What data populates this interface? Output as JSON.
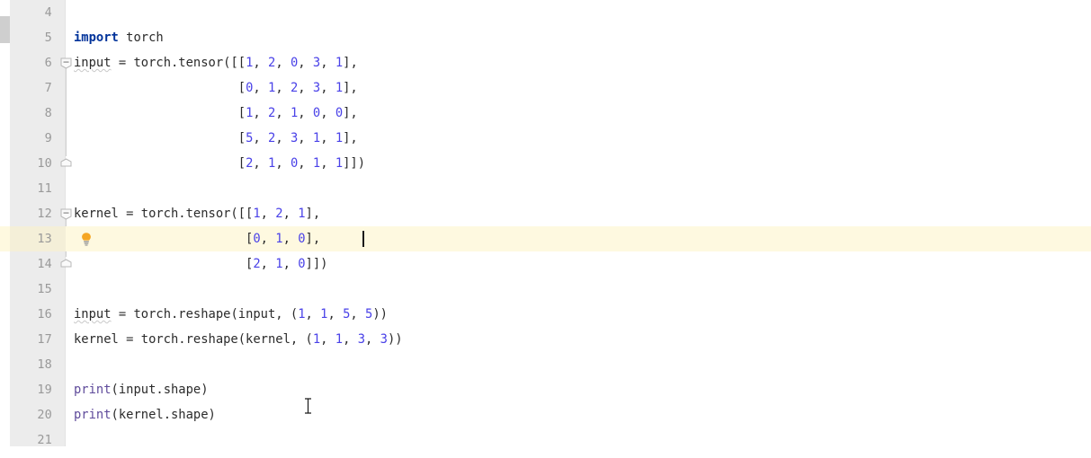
{
  "editor": {
    "app": "code-editor",
    "language": "python",
    "background_color": "#ffffff",
    "gutter_color": "#ececec",
    "highlight_color": "#fef9e0",
    "keyword_color": "#00329a",
    "number_color": "#4a42e8",
    "builtin_color": "#5f4b9b",
    "text_color": "#2b2b2b",
    "lineno_color": "#999999",
    "caret_line": 13,
    "lines": [
      {
        "num": "4",
        "text": ""
      },
      {
        "num": "5",
        "text": "import torch"
      },
      {
        "num": "6",
        "text": "input = torch.tensor([[1, 2, 0, 3, 1],"
      },
      {
        "num": "7",
        "text": "                      [0, 1, 2, 3, 1],"
      },
      {
        "num": "8",
        "text": "                      [1, 2, 1, 0, 0],"
      },
      {
        "num": "9",
        "text": "                      [5, 2, 3, 1, 1],"
      },
      {
        "num": "10",
        "text": "                      [2, 1, 0, 1, 1]])"
      },
      {
        "num": "11",
        "text": ""
      },
      {
        "num": "12",
        "text": "kernel = torch.tensor([[1, 2, 1],"
      },
      {
        "num": "13",
        "text": "                       [0, 1, 0],"
      },
      {
        "num": "14",
        "text": "                       [2, 1, 0]])"
      },
      {
        "num": "15",
        "text": ""
      },
      {
        "num": "16",
        "text": "input = torch.reshape(input, (1, 1, 5, 5))"
      },
      {
        "num": "17",
        "text": "kernel = torch.reshape(kernel, (1, 1, 3, 3))"
      },
      {
        "num": "18",
        "text": ""
      },
      {
        "num": "19",
        "text": "print(input.shape)"
      },
      {
        "num": "20",
        "text": "print(kernel.shape)"
      },
      {
        "num": "21",
        "text": ""
      }
    ],
    "icons": {
      "fold_open": "fold-minus-icon",
      "fold_end": "fold-end-icon",
      "intention": "lightbulb-icon",
      "mouse": "text-ibeam-cursor",
      "scrollbar": "vertical-scrollbar-thumb"
    }
  }
}
